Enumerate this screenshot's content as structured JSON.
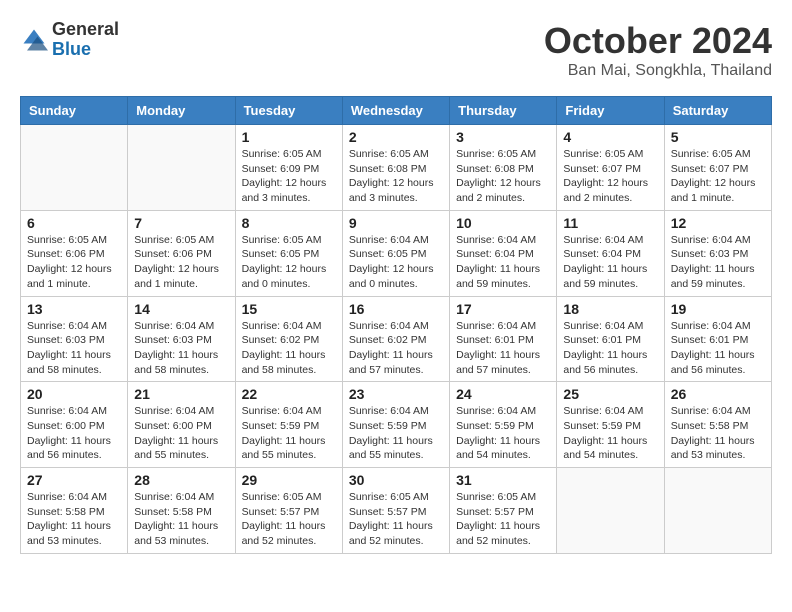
{
  "header": {
    "logo": {
      "line1": "General",
      "line2": "Blue"
    },
    "month": "October 2024",
    "location": "Ban Mai, Songkhla, Thailand"
  },
  "weekdays": [
    "Sunday",
    "Monday",
    "Tuesday",
    "Wednesday",
    "Thursday",
    "Friday",
    "Saturday"
  ],
  "weeks": [
    [
      {
        "day": "",
        "sunrise": "",
        "sunset": "",
        "daylight": ""
      },
      {
        "day": "",
        "sunrise": "",
        "sunset": "",
        "daylight": ""
      },
      {
        "day": "1",
        "sunrise": "Sunrise: 6:05 AM",
        "sunset": "Sunset: 6:09 PM",
        "daylight": "Daylight: 12 hours and 3 minutes."
      },
      {
        "day": "2",
        "sunrise": "Sunrise: 6:05 AM",
        "sunset": "Sunset: 6:08 PM",
        "daylight": "Daylight: 12 hours and 3 minutes."
      },
      {
        "day": "3",
        "sunrise": "Sunrise: 6:05 AM",
        "sunset": "Sunset: 6:08 PM",
        "daylight": "Daylight: 12 hours and 2 minutes."
      },
      {
        "day": "4",
        "sunrise": "Sunrise: 6:05 AM",
        "sunset": "Sunset: 6:07 PM",
        "daylight": "Daylight: 12 hours and 2 minutes."
      },
      {
        "day": "5",
        "sunrise": "Sunrise: 6:05 AM",
        "sunset": "Sunset: 6:07 PM",
        "daylight": "Daylight: 12 hours and 1 minute."
      }
    ],
    [
      {
        "day": "6",
        "sunrise": "Sunrise: 6:05 AM",
        "sunset": "Sunset: 6:06 PM",
        "daylight": "Daylight: 12 hours and 1 minute."
      },
      {
        "day": "7",
        "sunrise": "Sunrise: 6:05 AM",
        "sunset": "Sunset: 6:06 PM",
        "daylight": "Daylight: 12 hours and 1 minute."
      },
      {
        "day": "8",
        "sunrise": "Sunrise: 6:05 AM",
        "sunset": "Sunset: 6:05 PM",
        "daylight": "Daylight: 12 hours and 0 minutes."
      },
      {
        "day": "9",
        "sunrise": "Sunrise: 6:04 AM",
        "sunset": "Sunset: 6:05 PM",
        "daylight": "Daylight: 12 hours and 0 minutes."
      },
      {
        "day": "10",
        "sunrise": "Sunrise: 6:04 AM",
        "sunset": "Sunset: 6:04 PM",
        "daylight": "Daylight: 11 hours and 59 minutes."
      },
      {
        "day": "11",
        "sunrise": "Sunrise: 6:04 AM",
        "sunset": "Sunset: 6:04 PM",
        "daylight": "Daylight: 11 hours and 59 minutes."
      },
      {
        "day": "12",
        "sunrise": "Sunrise: 6:04 AM",
        "sunset": "Sunset: 6:03 PM",
        "daylight": "Daylight: 11 hours and 59 minutes."
      }
    ],
    [
      {
        "day": "13",
        "sunrise": "Sunrise: 6:04 AM",
        "sunset": "Sunset: 6:03 PM",
        "daylight": "Daylight: 11 hours and 58 minutes."
      },
      {
        "day": "14",
        "sunrise": "Sunrise: 6:04 AM",
        "sunset": "Sunset: 6:03 PM",
        "daylight": "Daylight: 11 hours and 58 minutes."
      },
      {
        "day": "15",
        "sunrise": "Sunrise: 6:04 AM",
        "sunset": "Sunset: 6:02 PM",
        "daylight": "Daylight: 11 hours and 58 minutes."
      },
      {
        "day": "16",
        "sunrise": "Sunrise: 6:04 AM",
        "sunset": "Sunset: 6:02 PM",
        "daylight": "Daylight: 11 hours and 57 minutes."
      },
      {
        "day": "17",
        "sunrise": "Sunrise: 6:04 AM",
        "sunset": "Sunset: 6:01 PM",
        "daylight": "Daylight: 11 hours and 57 minutes."
      },
      {
        "day": "18",
        "sunrise": "Sunrise: 6:04 AM",
        "sunset": "Sunset: 6:01 PM",
        "daylight": "Daylight: 11 hours and 56 minutes."
      },
      {
        "day": "19",
        "sunrise": "Sunrise: 6:04 AM",
        "sunset": "Sunset: 6:01 PM",
        "daylight": "Daylight: 11 hours and 56 minutes."
      }
    ],
    [
      {
        "day": "20",
        "sunrise": "Sunrise: 6:04 AM",
        "sunset": "Sunset: 6:00 PM",
        "daylight": "Daylight: 11 hours and 56 minutes."
      },
      {
        "day": "21",
        "sunrise": "Sunrise: 6:04 AM",
        "sunset": "Sunset: 6:00 PM",
        "daylight": "Daylight: 11 hours and 55 minutes."
      },
      {
        "day": "22",
        "sunrise": "Sunrise: 6:04 AM",
        "sunset": "Sunset: 5:59 PM",
        "daylight": "Daylight: 11 hours and 55 minutes."
      },
      {
        "day": "23",
        "sunrise": "Sunrise: 6:04 AM",
        "sunset": "Sunset: 5:59 PM",
        "daylight": "Daylight: 11 hours and 55 minutes."
      },
      {
        "day": "24",
        "sunrise": "Sunrise: 6:04 AM",
        "sunset": "Sunset: 5:59 PM",
        "daylight": "Daylight: 11 hours and 54 minutes."
      },
      {
        "day": "25",
        "sunrise": "Sunrise: 6:04 AM",
        "sunset": "Sunset: 5:59 PM",
        "daylight": "Daylight: 11 hours and 54 minutes."
      },
      {
        "day": "26",
        "sunrise": "Sunrise: 6:04 AM",
        "sunset": "Sunset: 5:58 PM",
        "daylight": "Daylight: 11 hours and 53 minutes."
      }
    ],
    [
      {
        "day": "27",
        "sunrise": "Sunrise: 6:04 AM",
        "sunset": "Sunset: 5:58 PM",
        "daylight": "Daylight: 11 hours and 53 minutes."
      },
      {
        "day": "28",
        "sunrise": "Sunrise: 6:04 AM",
        "sunset": "Sunset: 5:58 PM",
        "daylight": "Daylight: 11 hours and 53 minutes."
      },
      {
        "day": "29",
        "sunrise": "Sunrise: 6:05 AM",
        "sunset": "Sunset: 5:57 PM",
        "daylight": "Daylight: 11 hours and 52 minutes."
      },
      {
        "day": "30",
        "sunrise": "Sunrise: 6:05 AM",
        "sunset": "Sunset: 5:57 PM",
        "daylight": "Daylight: 11 hours and 52 minutes."
      },
      {
        "day": "31",
        "sunrise": "Sunrise: 6:05 AM",
        "sunset": "Sunset: 5:57 PM",
        "daylight": "Daylight: 11 hours and 52 minutes."
      },
      {
        "day": "",
        "sunrise": "",
        "sunset": "",
        "daylight": ""
      },
      {
        "day": "",
        "sunrise": "",
        "sunset": "",
        "daylight": ""
      }
    ]
  ]
}
